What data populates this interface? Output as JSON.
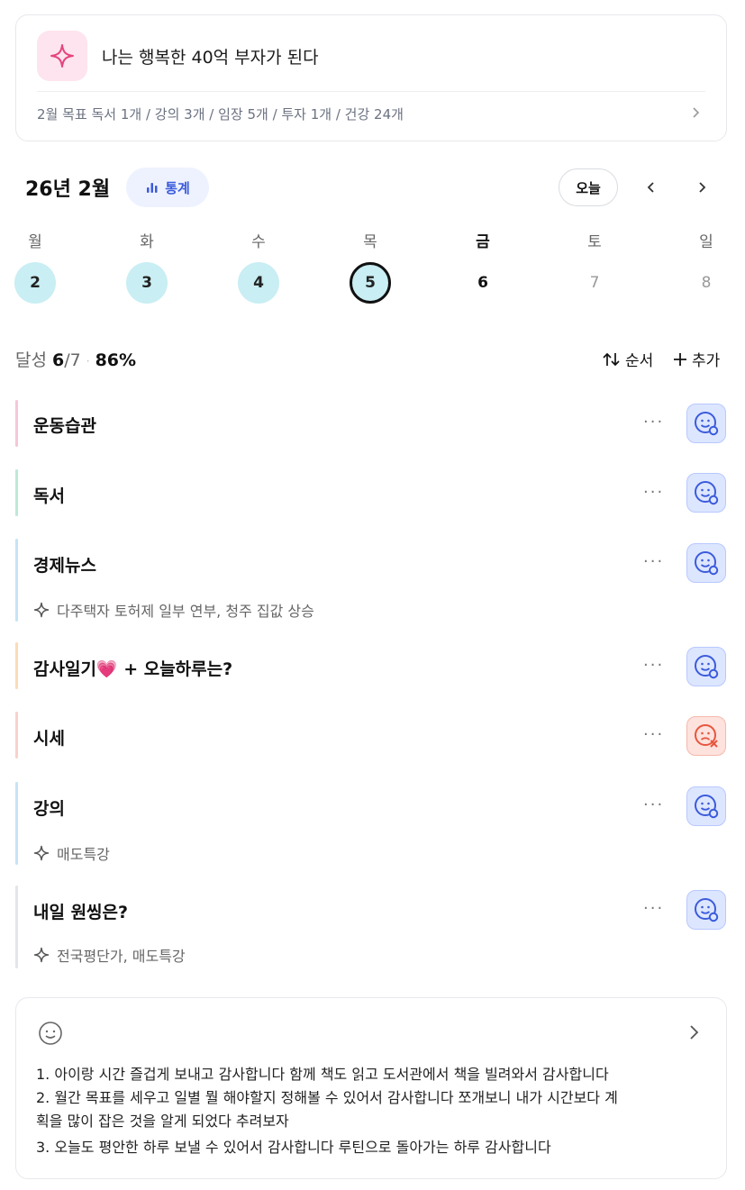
{
  "goal": {
    "title": "나는 행복한 40억 부자가 된다",
    "summary": "2월 목표  독서 1개 / 강의 3개 / 임장 5개 / 투자 1개 / 건강 24개"
  },
  "calendar": {
    "month_title": "26년 2월",
    "stats_label": "통계",
    "today_label": "오늘",
    "weekdays": [
      "월",
      "화",
      "수",
      "목",
      "금",
      "토",
      "일"
    ],
    "days": [
      "2",
      "3",
      "4",
      "5",
      "6",
      "7",
      "8"
    ]
  },
  "summary": {
    "label": "달성",
    "done": "6",
    "total": "/7",
    "percent": "86%",
    "order_label": "순서",
    "add_label": "추가"
  },
  "habits": [
    {
      "name": "운동습관",
      "note": "",
      "status": "ok",
      "color": "#f5c6d8"
    },
    {
      "name": "독서",
      "note": "",
      "status": "ok",
      "color": "#bfe8d7"
    },
    {
      "name": "경제뉴스",
      "note": "다주택자 토허제 일부 연부, 청주 집값 상승",
      "status": "ok",
      "color": "#c6e4f6"
    },
    {
      "name": "감사일기💗 + 오늘하루는?",
      "note": "",
      "status": "ok",
      "color": "#fbdcb8"
    },
    {
      "name": "시세",
      "note": "",
      "status": "fail",
      "color": "#f8d2cb"
    },
    {
      "name": "강의",
      "note": "매도특강",
      "status": "ok",
      "color": "#c6e4f6"
    },
    {
      "name": "내일 원씽은?",
      "note": "전국평단가, 매도특강",
      "status": "ok",
      "color": "#e3e5e8"
    }
  ],
  "journal": {
    "lines": [
      "1. 아이랑 시간 즐겁게 보내고 감사합니다 함께 책도 읽고 도서관에서 책을 빌려와서 감사합니다",
      "2. 월간 목표를 세우고 일별 뭘 해야할지 정해볼 수 있어서 감사합니다 쪼개보니 내가 시간보다 계",
      "획을 많이 잡은 것을 알게 되었다 추려보자",
      "3. 오늘도 평안한 하루 보낼 수 있어서 감사합니다 루틴으로 돌아가는 하루 감사합니다"
    ]
  },
  "colors": {
    "accent": "#3b5bdb",
    "done_day": "#c9eef3",
    "fail": "#e8553e"
  }
}
